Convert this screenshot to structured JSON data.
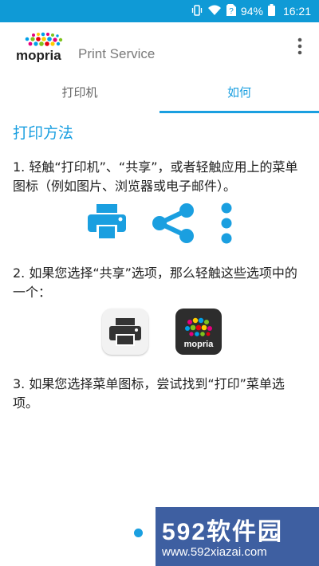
{
  "status_bar": {
    "battery_percent": "94%",
    "time": "16:21",
    "icons": [
      "vibrate-icon",
      "wifi-icon",
      "sim-unknown-icon",
      "battery-icon"
    ]
  },
  "app_bar": {
    "title": "Print Service",
    "logo_text": "mopria",
    "menu_icon": "more-vert-icon"
  },
  "tabs": [
    {
      "label": "打印机",
      "selected": false
    },
    {
      "label": "如何",
      "selected": true
    }
  ],
  "content": {
    "section_title": "打印方法",
    "step1": "1. 轻触“打印机”、“共享”，或者轻触应用上的菜单图标（例如图片、浏览器或电子邮件）。",
    "step1_icons": [
      "printer-icon",
      "share-icon",
      "more-vert-icon"
    ],
    "step2": "2. 如果您选择“共享”选项，那么轻触这些选项中的一个：",
    "step2_icons": [
      "print-app-icon",
      "mopria-app-icon"
    ],
    "step2_tile_label": "mopria",
    "step3": "3. 如果您选择菜单图标，尝试找到“打印”菜单选项。"
  },
  "watermark": {
    "title": "592软件园",
    "url": "www.592xiazai.com"
  },
  "colors": {
    "accent": "#1a9fe0",
    "status_bar": "#0f9ad6",
    "text": "#222222",
    "tab_inactive": "#666666"
  }
}
